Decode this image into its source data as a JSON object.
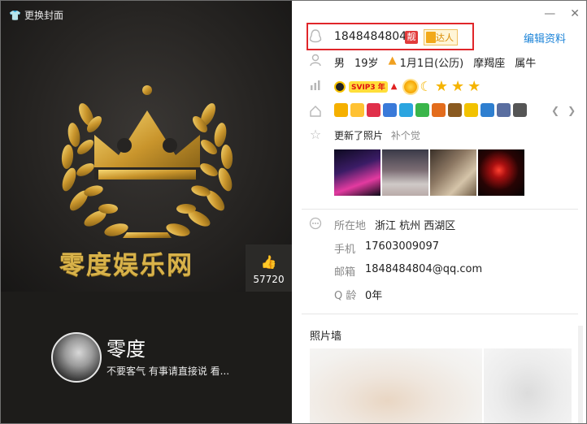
{
  "cover": {
    "change_cover_label": "更换封面",
    "brand_text": "零度娱乐网",
    "likes": "57720"
  },
  "user": {
    "nickname": "零度",
    "signature": "不要客气 有事请直接说 看..."
  },
  "profile": {
    "qq_number": "1848484804",
    "liang_badge": "靓",
    "daren_badge": "达人",
    "edit_label": "编辑资料",
    "gender": "男",
    "age": "19岁",
    "birthday": "1月1日(公历)",
    "constellation": "摩羯座",
    "zodiac": "属牛",
    "svip_label": "SVIP3 年",
    "update_text": "更新了照片",
    "update_sub": "补个觉"
  },
  "details": {
    "location_label": "所在地",
    "location_value": "浙江 杭州 西湖区",
    "phone_label": "手机",
    "phone_value": "17603009097",
    "email_label": "邮箱",
    "email_value": "1848484804@qq.com",
    "qage_label": "Q 龄",
    "qage_value": "0年"
  },
  "photo_wall": {
    "title": "照片墙"
  }
}
